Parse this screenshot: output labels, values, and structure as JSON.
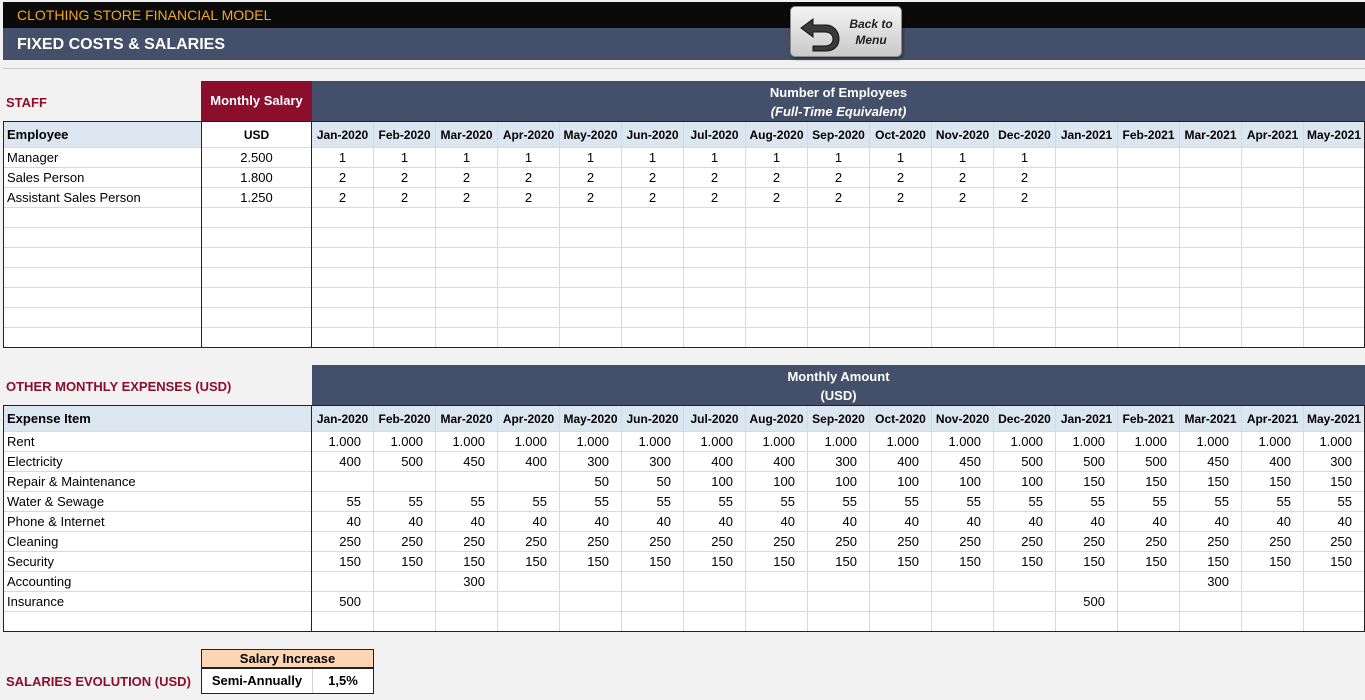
{
  "app": {
    "title": "CLOTHING STORE FINANCIAL MODEL",
    "sheet_title": "FIXED COSTS & SALARIES"
  },
  "back_button": {
    "label": "Back to\nMenu"
  },
  "months": [
    "Jan-2020",
    "Feb-2020",
    "Mar-2020",
    "Apr-2020",
    "May-2020",
    "Jun-2020",
    "Jul-2020",
    "Aug-2020",
    "Sep-2020",
    "Oct-2020",
    "Nov-2020",
    "Dec-2020",
    "Jan-2021",
    "Feb-2021",
    "Mar-2021",
    "Apr-2021",
    "May-2021"
  ],
  "staff": {
    "section_title": "STAFF",
    "salary_header": "Monthly Salary",
    "band_line1": "Number of Employees",
    "band_line2": "(Full-Time Equivalent)",
    "employee_header": "Employee",
    "currency_header": "USD",
    "rows": [
      {
        "name": "Manager",
        "salary": "2.500",
        "values": [
          "1",
          "1",
          "1",
          "1",
          "1",
          "1",
          "1",
          "1",
          "1",
          "1",
          "1",
          "1",
          "",
          "",
          "",
          "",
          ""
        ]
      },
      {
        "name": "Sales Person",
        "salary": "1.800",
        "values": [
          "2",
          "2",
          "2",
          "2",
          "2",
          "2",
          "2",
          "2",
          "2",
          "2",
          "2",
          "2",
          "",
          "",
          "",
          "",
          ""
        ]
      },
      {
        "name": "Assistant Sales Person",
        "salary": "1.250",
        "values": [
          "2",
          "2",
          "2",
          "2",
          "2",
          "2",
          "2",
          "2",
          "2",
          "2",
          "2",
          "2",
          "",
          "",
          "",
          "",
          ""
        ]
      },
      {
        "name": "",
        "salary": "",
        "values": [
          "",
          "",
          "",
          "",
          "",
          "",
          "",
          "",
          "",
          "",
          "",
          "",
          "",
          "",
          "",
          "",
          ""
        ]
      },
      {
        "name": "",
        "salary": "",
        "values": [
          "",
          "",
          "",
          "",
          "",
          "",
          "",
          "",
          "",
          "",
          "",
          "",
          "",
          "",
          "",
          "",
          ""
        ]
      },
      {
        "name": "",
        "salary": "",
        "values": [
          "",
          "",
          "",
          "",
          "",
          "",
          "",
          "",
          "",
          "",
          "",
          "",
          "",
          "",
          "",
          "",
          ""
        ]
      },
      {
        "name": "",
        "salary": "",
        "values": [
          "",
          "",
          "",
          "",
          "",
          "",
          "",
          "",
          "",
          "",
          "",
          "",
          "",
          "",
          "",
          "",
          ""
        ]
      },
      {
        "name": "",
        "salary": "",
        "values": [
          "",
          "",
          "",
          "",
          "",
          "",
          "",
          "",
          "",
          "",
          "",
          "",
          "",
          "",
          "",
          "",
          ""
        ]
      },
      {
        "name": "",
        "salary": "",
        "values": [
          "",
          "",
          "",
          "",
          "",
          "",
          "",
          "",
          "",
          "",
          "",
          "",
          "",
          "",
          "",
          "",
          ""
        ]
      },
      {
        "name": "",
        "salary": "",
        "values": [
          "",
          "",
          "",
          "",
          "",
          "",
          "",
          "",
          "",
          "",
          "",
          "",
          "",
          "",
          "",
          "",
          ""
        ]
      }
    ]
  },
  "expenses": {
    "section_title": "OTHER MONTHLY EXPENSES (USD)",
    "band_line1": "Monthly Amount",
    "band_line2": "(USD)",
    "item_header": "Expense Item",
    "rows": [
      {
        "name": "Rent",
        "values": [
          "1.000",
          "1.000",
          "1.000",
          "1.000",
          "1.000",
          "1.000",
          "1.000",
          "1.000",
          "1.000",
          "1.000",
          "1.000",
          "1.000",
          "1.000",
          "1.000",
          "1.000",
          "1.000",
          "1.000"
        ]
      },
      {
        "name": "Electricity",
        "values": [
          "400",
          "500",
          "450",
          "400",
          "300",
          "300",
          "400",
          "400",
          "300",
          "400",
          "450",
          "500",
          "500",
          "500",
          "450",
          "400",
          "300"
        ]
      },
      {
        "name": "Repair & Maintenance",
        "values": [
          "",
          "",
          "",
          "",
          "50",
          "50",
          "100",
          "100",
          "100",
          "100",
          "100",
          "100",
          "150",
          "150",
          "150",
          "150",
          "150"
        ]
      },
      {
        "name": "Water & Sewage",
        "values": [
          "55",
          "55",
          "55",
          "55",
          "55",
          "55",
          "55",
          "55",
          "55",
          "55",
          "55",
          "55",
          "55",
          "55",
          "55",
          "55",
          "55"
        ]
      },
      {
        "name": "Phone & Internet",
        "values": [
          "40",
          "40",
          "40",
          "40",
          "40",
          "40",
          "40",
          "40",
          "40",
          "40",
          "40",
          "40",
          "40",
          "40",
          "40",
          "40",
          "40"
        ]
      },
      {
        "name": "Cleaning",
        "values": [
          "250",
          "250",
          "250",
          "250",
          "250",
          "250",
          "250",
          "250",
          "250",
          "250",
          "250",
          "250",
          "250",
          "250",
          "250",
          "250",
          "250"
        ]
      },
      {
        "name": "Security",
        "values": [
          "150",
          "150",
          "150",
          "150",
          "150",
          "150",
          "150",
          "150",
          "150",
          "150",
          "150",
          "150",
          "150",
          "150",
          "150",
          "150",
          "150"
        ]
      },
      {
        "name": "Accounting",
        "values": [
          "",
          "",
          "300",
          "",
          "",
          "",
          "",
          "",
          "",
          "",
          "",
          "",
          "",
          "",
          "300",
          "",
          ""
        ]
      },
      {
        "name": "Insurance",
        "values": [
          "500",
          "",
          "",
          "",
          "",
          "",
          "",
          "",
          "",
          "",
          "",
          "",
          "500",
          "",
          "",
          "",
          ""
        ]
      },
      {
        "name": "",
        "values": [
          "",
          "",
          "",
          "",
          "",
          "",
          "",
          "",
          "",
          "",
          "",
          "",
          "",
          "",
          "",
          "",
          ""
        ]
      }
    ]
  },
  "salaries_evolution": {
    "section_title": "SALARIES EVOLUTION (USD)",
    "increase_header": "Salary Increase",
    "frequency": "Semi-Annually",
    "rate": "1,5%"
  },
  "colors": {
    "header_navy": "#445069",
    "accent_maroon": "#8b0e2c",
    "title_orange": "#f4a81c",
    "header_light_blue": "#dce6f1",
    "increase_peach": "#fcd5b4"
  }
}
